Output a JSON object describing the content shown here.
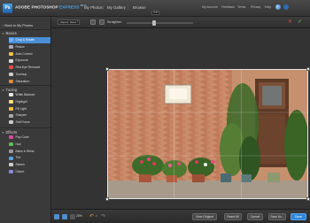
{
  "topbar": {
    "logo_letter": "Ps",
    "brand_prefix": "ADOBE",
    "brand_main": "PHOTOSHOP",
    "brand_express": "EXPRESS",
    "brand_beta": "BETA",
    "nav": [
      "My Photos",
      "My Gallery",
      "Browse"
    ],
    "nav_sep": "|",
    "links": [
      "My Account",
      "Feedback",
      "Terms",
      "Privacy",
      "Help"
    ]
  },
  "sidebar": {
    "back_label": "‹ Back to My Photos",
    "sections": [
      {
        "title": "Basics",
        "items": [
          {
            "label": "Crop & Rotate",
            "icon": "crop-rotate-icon",
            "color": "#6fb2ff",
            "selected": true
          },
          {
            "label": "Resize",
            "icon": "resize-icon",
            "color": "#aab",
            "selected": false
          },
          {
            "label": "Auto Correct",
            "icon": "auto-correct-icon",
            "color": "#e8c24a",
            "selected": false
          },
          {
            "label": "Exposure",
            "icon": "exposure-icon",
            "color": "#ddd",
            "selected": false
          },
          {
            "label": "Red-Eye Removal",
            "icon": "red-eye-icon",
            "color": "#e04a4a",
            "selected": false
          },
          {
            "label": "Touchup",
            "icon": "touchup-icon",
            "color": "#ccc",
            "selected": false
          },
          {
            "label": "Saturation",
            "icon": "saturation-icon",
            "color": "#e08a3a",
            "selected": false
          }
        ]
      },
      {
        "title": "Tuning",
        "items": [
          {
            "label": "White Balance",
            "icon": "white-balance-icon",
            "color": "#e8e8e8",
            "selected": false
          },
          {
            "label": "Highlight",
            "icon": "highlight-icon",
            "color": "#f5e07a",
            "selected": false
          },
          {
            "label": "Fill Light",
            "icon": "fill-light-icon",
            "color": "#f0c040",
            "selected": false
          },
          {
            "label": "Sharpen",
            "icon": "sharpen-icon",
            "color": "#aaa",
            "selected": false
          },
          {
            "label": "Soft Focus",
            "icon": "soft-focus-icon",
            "color": "#ccc",
            "selected": false
          }
        ]
      },
      {
        "title": "Effects",
        "items": [
          {
            "label": "Pop Color",
            "icon": "pop-color-icon",
            "color": "#d84a9c",
            "selected": false
          },
          {
            "label": "Hue",
            "icon": "hue-icon",
            "color": "#5ac05a",
            "selected": false
          },
          {
            "label": "Black & White",
            "icon": "black-white-icon",
            "color": "#999",
            "selected": false
          },
          {
            "label": "Tint",
            "icon": "tint-icon",
            "color": "#5aa0e0",
            "selected": false
          },
          {
            "label": "Sketch",
            "icon": "sketch-icon",
            "color": "#ccc",
            "selected": false
          },
          {
            "label": "Distort",
            "icon": "distort-icon",
            "color": "#88d",
            "selected": false
          }
        ]
      }
    ]
  },
  "toolbar": {
    "aspect_label": "Aspect: None",
    "straighten_label": "Straighten",
    "tooltip": "-0.47",
    "rotate_icon": "rotate-icon",
    "flip_icon": "flip-icon",
    "cancel_icon": "cancel-x-icon",
    "confirm_icon": "confirm-check-icon"
  },
  "bottombar": {
    "zoom": "25%",
    "buttons": [
      "View Original",
      "Reset All",
      "Cancel",
      "Save As..."
    ],
    "done_label": "Done"
  },
  "colors": {
    "accent": "#4a8fd6",
    "primary_button": "#2f86d8",
    "undo_orange": "#e39a2e"
  }
}
